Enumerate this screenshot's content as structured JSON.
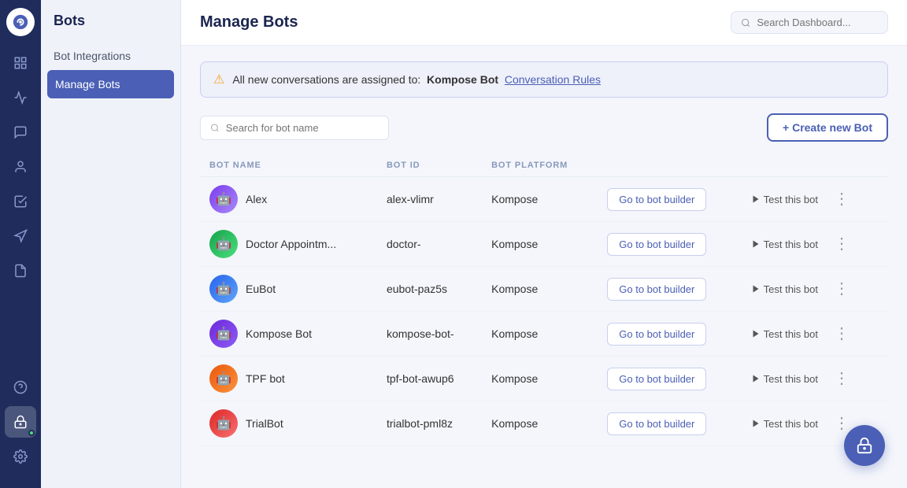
{
  "sidebar": {
    "title": "Bots",
    "icons": [
      {
        "name": "home-icon",
        "symbol": "⊞",
        "active": false
      },
      {
        "name": "chart-icon",
        "symbol": "📊",
        "active": false
      },
      {
        "name": "chat-icon",
        "symbol": "💬",
        "active": false
      },
      {
        "name": "contacts-icon",
        "symbol": "👤",
        "active": false
      },
      {
        "name": "inbox-icon",
        "symbol": "☰",
        "active": false
      },
      {
        "name": "campaigns-icon",
        "symbol": "📣",
        "active": false
      },
      {
        "name": "reports-icon",
        "symbol": "📋",
        "active": false
      }
    ],
    "bottom_icons": [
      {
        "name": "help-icon",
        "symbol": "?"
      },
      {
        "name": "bot-active-icon",
        "symbol": "🤖"
      },
      {
        "name": "settings-icon",
        "symbol": "⚙"
      }
    ]
  },
  "panel": {
    "title": "Bots",
    "menu_items": [
      {
        "label": "Bot Integrations",
        "active": false
      },
      {
        "label": "Manage Bots",
        "active": true
      }
    ]
  },
  "header": {
    "title": "Manage Bots",
    "search_placeholder": "Search Dashboard..."
  },
  "alert": {
    "text_prefix": "All new conversations are assigned to:",
    "bot_name": "Kompose Bot",
    "link_text": "Conversation Rules"
  },
  "toolbar": {
    "search_placeholder": "Search for bot name",
    "create_label": "+ Create new Bot"
  },
  "table": {
    "columns": [
      "BOT NAME",
      "BOT ID",
      "BOT PLATFORM",
      "",
      ""
    ],
    "rows": [
      {
        "name": "Alex",
        "id": "alex-vlimr",
        "platform": "Kompose",
        "avatar_color": "purple",
        "avatar_emoji": "🤖"
      },
      {
        "name": "Doctor Appointm...",
        "id": "doctor-",
        "platform": "Kompose",
        "avatar_color": "green",
        "avatar_emoji": "🤖"
      },
      {
        "name": "EuBot",
        "id": "eubot-paz5s",
        "platform": "Kompose",
        "avatar_color": "blue",
        "avatar_emoji": "🤖"
      },
      {
        "name": "Kompose Bot",
        "id": "kompose-bot-",
        "platform": "Kompose",
        "avatar_color": "purple",
        "avatar_emoji": "🤖"
      },
      {
        "name": "TPF bot",
        "id": "tpf-bot-awup6",
        "platform": "Kompose",
        "avatar_color": "orange",
        "avatar_emoji": "🤖"
      },
      {
        "name": "TrialBot",
        "id": "trialbot-pml8z",
        "platform": "Kompose",
        "avatar_color": "red",
        "avatar_emoji": "🤖"
      }
    ],
    "go_btn_label": "Go to bot builder",
    "test_btn_label": "Test this bot"
  }
}
